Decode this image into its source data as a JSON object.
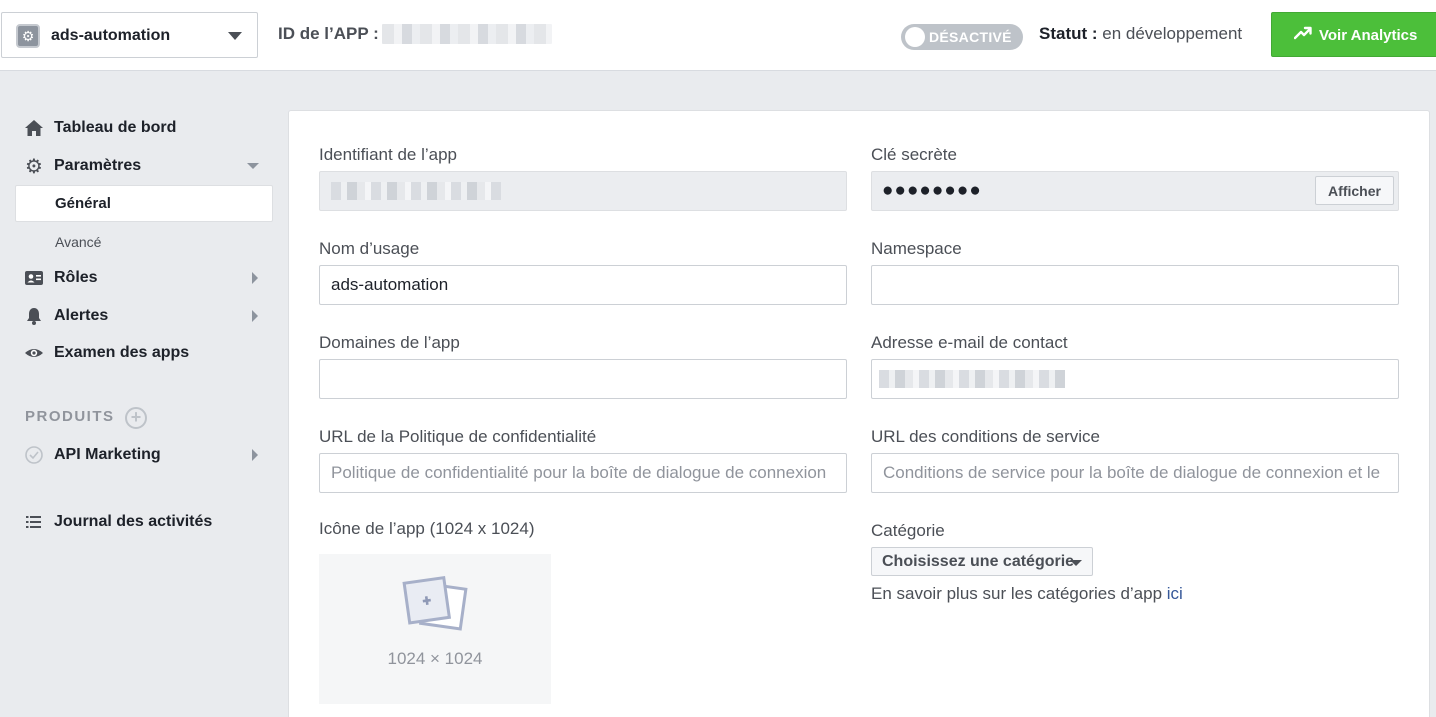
{
  "header": {
    "app_name": "ads-automation",
    "app_id_label": "ID de l’APP :",
    "toggle_label": "DÉSACTIVÉ",
    "status_label": "Statut :",
    "status_value": " en développement",
    "analytics_button": "Voir Analytics",
    "analytics_color": "#4cbf3a"
  },
  "sidebar": {
    "items": [
      {
        "label": "Tableau de bord",
        "icon": "home-icon"
      },
      {
        "label": "Paramètres",
        "icon": "gear-icon"
      },
      {
        "label": "Général"
      },
      {
        "label": "Avancé"
      },
      {
        "label": "Rôles",
        "icon": "contact-card-icon"
      },
      {
        "label": "Alertes",
        "icon": "bell-icon"
      },
      {
        "label": "Examen des apps",
        "icon": "eye-icon"
      }
    ],
    "products_heading": "PRODUITS",
    "products": [
      {
        "label": "API Marketing",
        "icon": "check-circle-icon"
      }
    ],
    "activity_log": "Journal des activités"
  },
  "form": {
    "app_id_label": "Identifiant de l’app",
    "secret_label": "Clé secrète",
    "secret_masked": "●●●●●●●●",
    "show_button": "Afficher",
    "display_name_label": "Nom d’usage",
    "display_name_value": "ads-automation",
    "namespace_label": "Namespace",
    "namespace_value": "",
    "domains_label": "Domaines de l’app",
    "domains_value": "",
    "contact_email_label": "Adresse e-mail de contact",
    "privacy_url_label": "URL de la Politique de confidentialité",
    "privacy_url_placeholder": "Politique de confidentialité pour la boîte de dialogue de connexion",
    "tos_url_label": "URL des conditions de service",
    "tos_url_placeholder": "Conditions de service pour la boîte de dialogue de connexion et le",
    "app_icon_label": "Icône de l’app (1024 x 1024)",
    "app_icon_placeholder": "1024 × 1024",
    "category_label": "Catégorie",
    "category_select": "Choisissez une catégorie",
    "category_help": "En savoir plus sur les catégories d’app ",
    "category_help_link": "ici"
  }
}
